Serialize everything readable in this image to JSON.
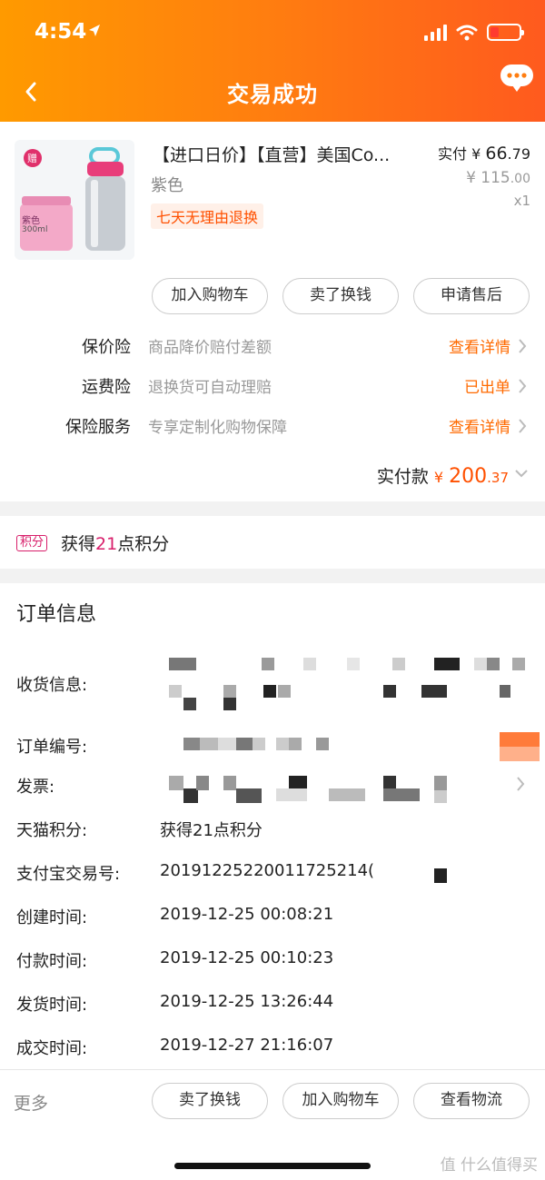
{
  "status_bar": {
    "time": "4:54"
  },
  "header": {
    "title": "交易成功"
  },
  "product": {
    "title": "【进口日价】【直营】美国Co...",
    "spec": "紫色",
    "tag": "七天无理由退换",
    "price_label": "实付",
    "price_symbol": "¥",
    "price_int": "66",
    "price_dec": ".79",
    "original_price_int": "¥ 115",
    "original_price_dec": ".00",
    "quantity": "x1",
    "thumb_badge": "赠",
    "thumb_color_label": "紫色",
    "thumb_volume": "300ml"
  },
  "actions": {
    "add_cart": "加入购物车",
    "sell": "卖了换钱",
    "after_sale": "申请售后"
  },
  "insurance": [
    {
      "label": "保价险",
      "desc": "商品降价赔付差额",
      "link": "查看详情"
    },
    {
      "label": "运费险",
      "desc": "退换货可自动理赔",
      "link": "已出单"
    },
    {
      "label": "保险服务",
      "desc": "专享定制化购物保障",
      "link": "查看详情"
    }
  ],
  "total": {
    "label": "实付款",
    "symbol": "¥",
    "int": "200",
    "dec": ".37"
  },
  "points": {
    "badge": "积分",
    "text_pre": "获得",
    "num": "21",
    "text_post": "点积分"
  },
  "order_info": {
    "title": "订单信息",
    "rows": [
      {
        "label": "收货信息:",
        "value": ""
      },
      {
        "label": "订单编号:",
        "value": ""
      },
      {
        "label": "发票:",
        "value": ""
      },
      {
        "label": "天猫积分:",
        "value": "获得21点积分"
      },
      {
        "label": "支付宝交易号:",
        "value": "20191225220011725214("
      },
      {
        "label": "创建时间:",
        "value": "2019-12-25 00:08:21"
      },
      {
        "label": "付款时间:",
        "value": "2019-12-25 00:10:23"
      },
      {
        "label": "发货时间:",
        "value": "2019-12-25 13:26:44"
      },
      {
        "label": "成交时间:",
        "value": "2019-12-27 21:16:07"
      }
    ]
  },
  "bottom_bar": {
    "more": "更多",
    "sell": "卖了换钱",
    "add_cart": "加入购物车",
    "logistics": "查看物流"
  },
  "watermark": "值 什么值得买",
  "colors": {
    "header_start": "#ff9a00",
    "header_end": "#ff5a1e",
    "accent": "#ff5000",
    "link": "#ff6a00",
    "points": "#d81e6a"
  }
}
